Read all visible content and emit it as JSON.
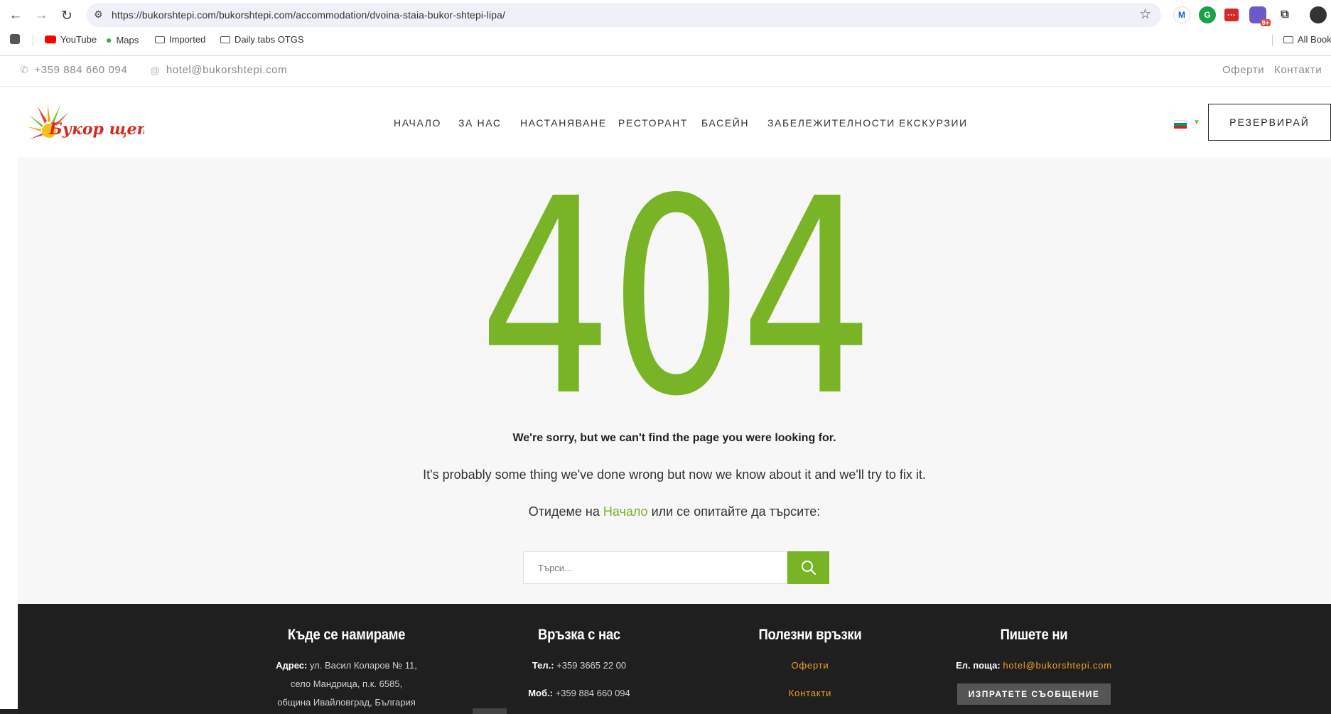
{
  "browser": {
    "url": "https://bukorshtepi.com/bukorshtepi.com/accommodation/dvoina-staia-bukor-shtepi-lipa/",
    "bookmarks": [
      "YouTube",
      "Maps",
      "Imported",
      "Daily tabs OTGS"
    ],
    "all_bookmarks": "All Bookmarks",
    "ext_badge": "9+"
  },
  "topbar": {
    "phone": "+359 884 660 094",
    "email": "hotel@bukorshtepi.com",
    "links": [
      "Оферти",
      "Контакти"
    ]
  },
  "header": {
    "logo_text": "Букор щепи",
    "nav": [
      "НАЧАЛО",
      "ЗА НАС",
      "НАСТАНЯВАНЕ",
      "РЕСТОРАНТ",
      "БАСЕЙН",
      "ЗАБЕЛЕЖИТЕЛНОСТИ",
      "ЕКСКУРЗИИ"
    ],
    "reserve": "РЕЗЕРВИРАЙ"
  },
  "error": {
    "code": "404",
    "sorry": "We're sorry, but we can't find the page you were looking for.",
    "probably": "It's probably some thing we've done wrong but now we know about it and we'll try to fix it.",
    "goto_prefix": "Отидеме на ",
    "goto_link": "Начало",
    "goto_suffix": " или се опитайте да търсите:",
    "search_placeholder": "Търси..."
  },
  "footer": {
    "col1": {
      "title": "Къде се намираме",
      "addr_label": "Адрес:",
      "addr1": " ул. Васил Коларов № 11,",
      "addr2": "село Мандрица, п.к. 6585,",
      "addr3": "община Ивайловград, България"
    },
    "col2": {
      "title": "Връзка с нас",
      "tel_label": "Тел.:",
      "tel": " +359 3665 22 00",
      "mob_label": "Моб.:",
      "mob": " +359 884 660 094"
    },
    "col3": {
      "title": "Полезни връзки",
      "link1": "Оферти",
      "link2": "Контакти"
    },
    "col4": {
      "title": "Пишете ни",
      "email_label": "Ел. поща: ",
      "email": "hotel@bukorshtepi.com",
      "button": "ИЗПРАТЕТЕ СЪОБЩЕНИЕ"
    }
  },
  "colors": {
    "accent": "#78b425",
    "footer_bg": "#1f1f1f",
    "footer_link": "#f0a020"
  }
}
